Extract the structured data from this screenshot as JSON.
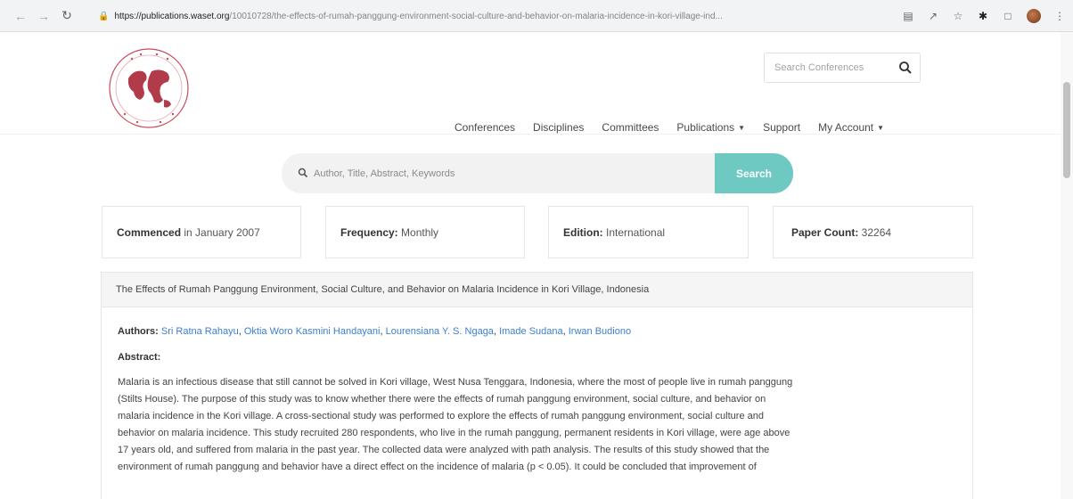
{
  "browser": {
    "url_host": "https://publications.waset.org",
    "url_path": "/10010728/the-effects-of-rumah-panggung-environment-social-culture-and-behavior-on-malaria-incidence-in-kori-village-ind..."
  },
  "header": {
    "search_placeholder": "Search Conferences",
    "nav": [
      {
        "label": "Conferences"
      },
      {
        "label": "Disciplines"
      },
      {
        "label": "Committees"
      },
      {
        "label": "Publications"
      },
      {
        "label": "Support"
      },
      {
        "label": "My Account"
      }
    ]
  },
  "paper_search": {
    "placeholder": "Author, Title, Abstract, Keywords",
    "button_label": "Search"
  },
  "stats": {
    "commenced_label": "Commenced",
    "commenced_value": " in January 2007",
    "frequency_label": "Frequency:",
    "frequency_value": " Monthly",
    "edition_label": "Edition:",
    "edition_value": " International",
    "paper_count_label": "Paper Count:",
    "paper_count_value": " 32264"
  },
  "paper": {
    "title": "The Effects of Rumah Panggung Environment, Social Culture, and Behavior on Malaria Incidence in Kori Village, Indonesia",
    "authors_label": "Authors:",
    "authors": [
      "Sri Ratna Rahayu",
      "Oktia Woro Kasmini Handayani",
      "Lourensiana Y. S. Ngaga",
      "Imade Sudana",
      "Irwan Budiono"
    ],
    "abstract_heading": "Abstract:",
    "abstract_lines": [
      "Malaria is an infectious disease that still cannot be solved in Kori village, West Nusa Tenggara, Indonesia, where the most of people live in rumah panggung",
      "(Stilts House). The purpose of this study was to know whether there were the effects of rumah panggung environment, social culture, and behavior on",
      "malaria incidence in the Kori village. A cross-sectional study was performed to explore the effects of rumah panggung environment, social culture and",
      "behavior on malaria incidence. This study recruited 280 respondents, who live in the rumah panggung, permanent residents in Kori village, were age above",
      "17 years old, and suffered from malaria in the past year. The collected data were analyzed with path analysis. The results of this study showed that the",
      "environment of rumah panggung and behavior have a direct effect on the incidence of malaria (p < 0.05). It could be concluded that improvement of"
    ]
  },
  "colors": {
    "search_button": "#6dc9c2",
    "author_link": "#3b7fd1"
  }
}
